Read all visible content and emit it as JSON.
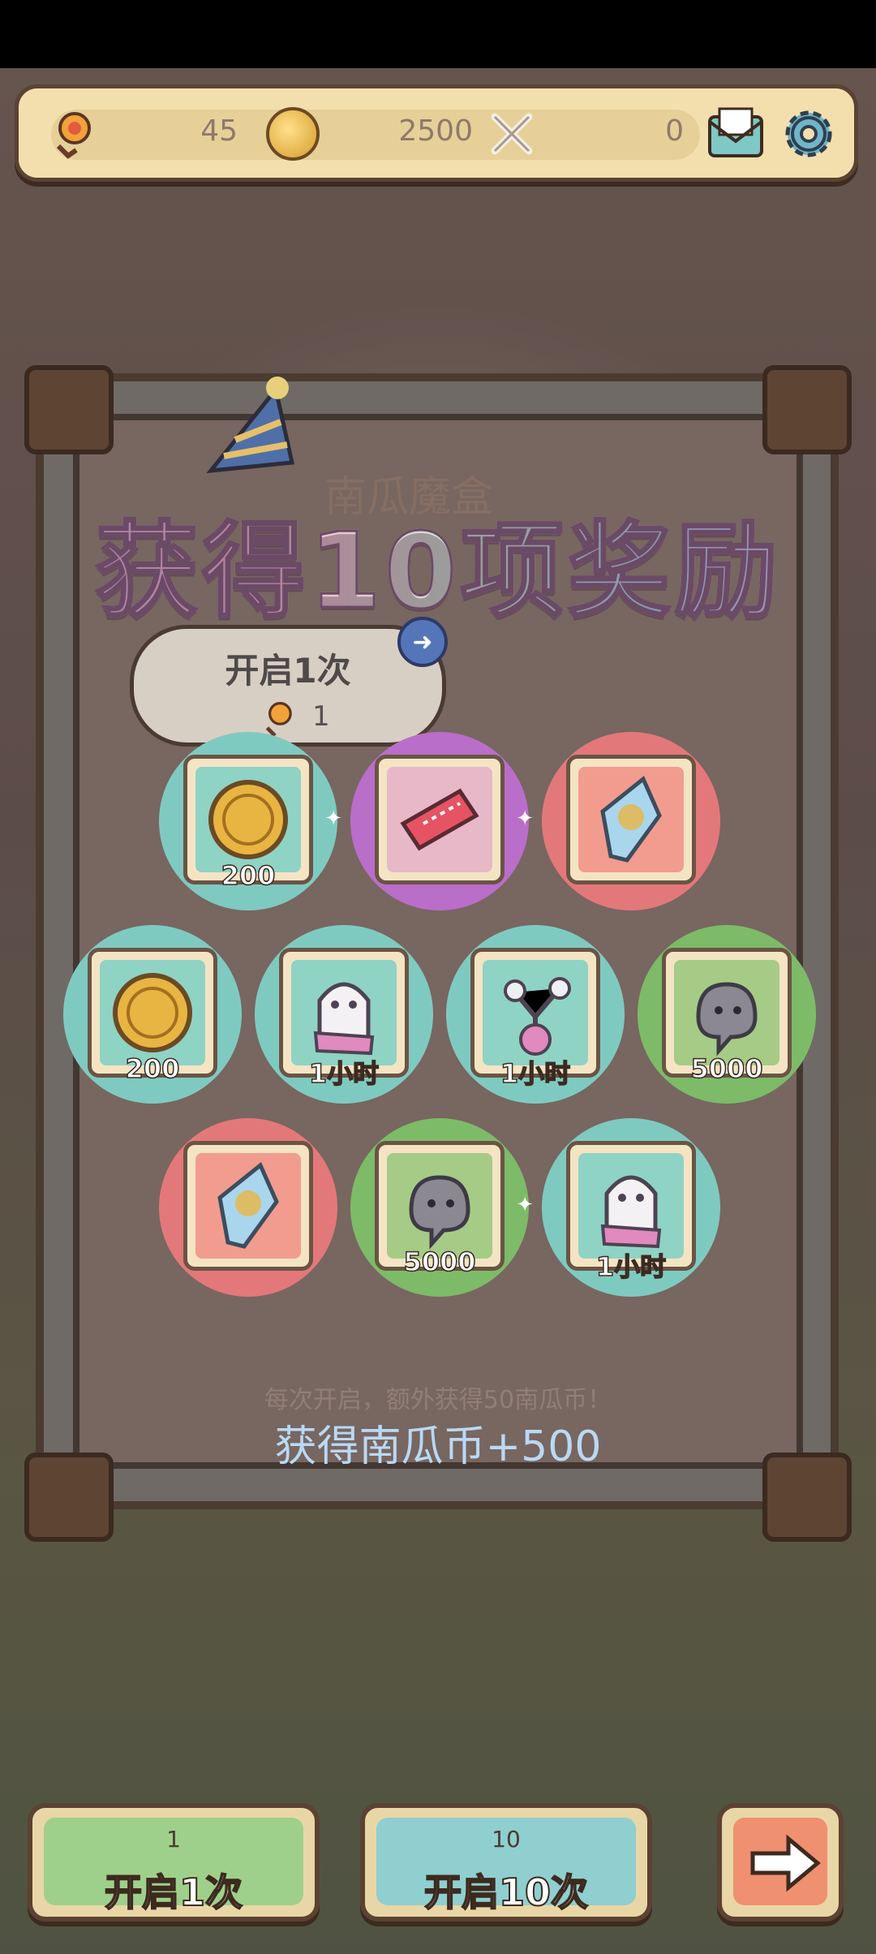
{
  "resources": [
    {
      "name": "flower-token",
      "value": "45"
    },
    {
      "name": "pumpkin-coin",
      "value": "2500"
    },
    {
      "name": "crossed-bones",
      "value": "0"
    }
  ],
  "modal": {
    "faded_title": "南瓜魔盒",
    "headline": "获得10项奖励",
    "open_once_label": "开启1次",
    "open_once_count": "1",
    "bonus_note": "每次开启，额外获得50南瓜币！",
    "gain_text": "获得南瓜币+500"
  },
  "rewards": [
    {
      "item": "pumpkin-coin",
      "qty": "200",
      "bg": "#7fcac0"
    },
    {
      "item": "ticket",
      "qty": "",
      "bg": "#b96ec9"
    },
    {
      "item": "crystal",
      "qty": "",
      "bg": "#e3787a"
    },
    {
      "item": "pumpkin-coin",
      "qty": "200",
      "bg": "#7fcac0"
    },
    {
      "item": "ghost-costume",
      "qty": "1小时",
      "bg": "#7fcac0"
    },
    {
      "item": "potion",
      "qty": "1小时",
      "bg": "#7fcac0"
    },
    {
      "item": "soul-blob",
      "qty": "5000",
      "bg": "#7dbb68"
    },
    {
      "item": "crystal",
      "qty": "",
      "bg": "#e3787a"
    },
    {
      "item": "soul-blob",
      "qty": "5000",
      "bg": "#7dbb68"
    },
    {
      "item": "ghost-costume",
      "qty": "1小时",
      "bg": "#7fcac0"
    }
  ],
  "buttons": {
    "open_once": {
      "cost": "1",
      "label": "开启1次"
    },
    "open_ten": {
      "cost": "10",
      "label": "开启10次"
    }
  }
}
